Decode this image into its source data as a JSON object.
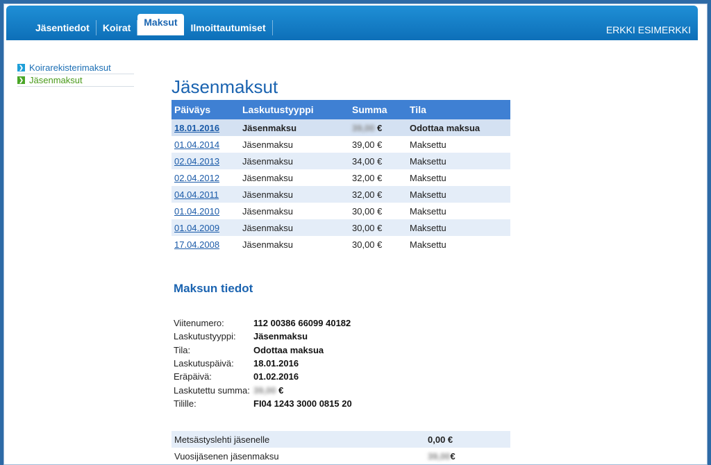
{
  "nav": {
    "items": [
      "Jäsentiedot",
      "Koirat",
      "Maksut",
      "Ilmoittautumiset"
    ],
    "active": "Maksut"
  },
  "user": {
    "name": "ERKKI ESIMERKKI"
  },
  "sidebar": {
    "items": [
      {
        "label": "Koirarekisterimaksut",
        "icon": "chevron-right-icon"
      },
      {
        "label": "Jäsenmaksut",
        "icon": "chevron-right-icon"
      }
    ]
  },
  "page": {
    "title": "Jäsenmaksut"
  },
  "payments": {
    "headers": [
      "Päiväys",
      "Laskutustyyppi",
      "Summa",
      "Tila"
    ],
    "rows": [
      {
        "date": "18.01.2016",
        "type": "Jäsenmaksu",
        "sum_hidden": "39,00",
        "sum_currency": "€",
        "status": "Odottaa maksua"
      },
      {
        "date": "01.04.2014",
        "type": "Jäsenmaksu",
        "sum": "39,00 €",
        "status": "Maksettu"
      },
      {
        "date": "02.04.2013",
        "type": "Jäsenmaksu",
        "sum": "34,00 €",
        "status": "Maksettu"
      },
      {
        "date": "02.04.2012",
        "type": "Jäsenmaksu",
        "sum": "32,00 €",
        "status": "Maksettu"
      },
      {
        "date": "04.04.2011",
        "type": "Jäsenmaksu",
        "sum": "32,00 €",
        "status": "Maksettu"
      },
      {
        "date": "01.04.2010",
        "type": "Jäsenmaksu",
        "sum": "30,00 €",
        "status": "Maksettu"
      },
      {
        "date": "01.04.2009",
        "type": "Jäsenmaksu",
        "sum": "30,00 €",
        "status": "Maksettu"
      },
      {
        "date": "17.04.2008",
        "type": "Jäsenmaksu",
        "sum": "30,00 €",
        "status": "Maksettu"
      }
    ]
  },
  "details": {
    "title": "Maksun tiedot",
    "rows": [
      {
        "label": "Viitenumero:",
        "value": "112 00386 66099 40182"
      },
      {
        "label": "Laskutustyyppi:",
        "value": "Jäsenmaksu"
      },
      {
        "label": "Tila:",
        "value": "Odottaa maksua"
      },
      {
        "label": "Laskutuspäivä:",
        "value": "18.01.2016"
      },
      {
        "label": "Eräpäivä:",
        "value": "01.02.2016"
      },
      {
        "label": "Laskutettu summa:",
        "value_hidden": "39,00",
        "value_suffix": "€"
      },
      {
        "label": "Tilille:",
        "value": "FI04 1243 3000 0815 20"
      }
    ]
  },
  "extras": {
    "rows": [
      {
        "label": "Metsästyslehti jäsenelle",
        "value": "0,00 €"
      },
      {
        "label": "Vuosijäsenen jäsenmaksu",
        "value_hidden": "39,00",
        "value_suffix": "€"
      }
    ]
  }
}
